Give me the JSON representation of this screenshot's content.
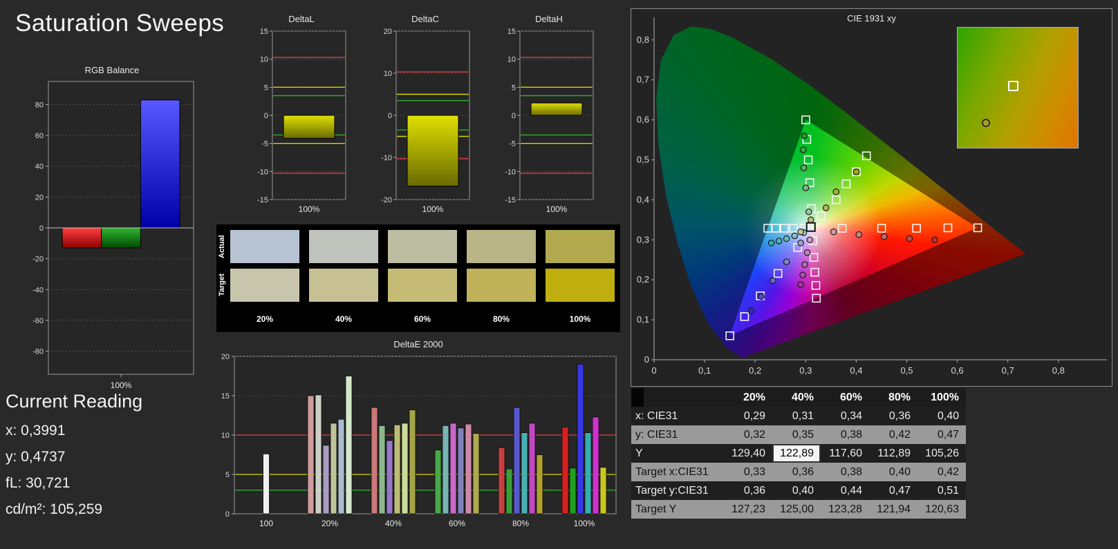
{
  "page": {
    "title": "Saturation Sweeps"
  },
  "reading": {
    "title": "Current Reading",
    "lines": [
      "x: 0,3991",
      "y: 0,4737",
      "fL: 30,721",
      "cd/m²: 105,259"
    ]
  },
  "rgb_balance": {
    "title": "RGB Balance",
    "x_label": "100%",
    "ymin": -95,
    "ymax": 95,
    "yticks": [
      80,
      60,
      40,
      20,
      0,
      -20,
      -40,
      -60,
      -80
    ],
    "bars": [
      {
        "name": "red",
        "value": -13,
        "c1": "#ff4040",
        "c2": "#8c0000"
      },
      {
        "name": "green",
        "value": -13,
        "c1": "#30b430",
        "c2": "#004a00"
      },
      {
        "name": "blue",
        "value": 83,
        "c1": "#5858ff",
        "c2": "#0000a8"
      }
    ]
  },
  "bar_gradient": [
    "#e0e000",
    "#6a6a00"
  ],
  "delta_ref_lines": [
    {
      "value": 10.3,
      "color": "#e04040"
    },
    {
      "value": 5,
      "color": "#d6d600"
    },
    {
      "value": 3.5,
      "color": "#30b030"
    },
    {
      "value": -3.5,
      "color": "#30b030"
    },
    {
      "value": -5,
      "color": "#d6d600"
    },
    {
      "value": -10.3,
      "color": "#e04040"
    }
  ],
  "delta_charts": [
    {
      "id": "deltal",
      "title": "DeltaL",
      "x_label": "100%",
      "ymin": -15,
      "ymax": 15,
      "yticks": [
        15,
        10,
        5,
        0,
        -5,
        -10,
        -15
      ],
      "bar": -4.1
    },
    {
      "id": "deltac",
      "title": "DeltaC",
      "x_label": "100%",
      "ymin": -20,
      "ymax": 20,
      "yticks": [
        20,
        10,
        0,
        -10,
        -20
      ],
      "bar": -16.8
    },
    {
      "id": "deltah",
      "title": "DeltaH",
      "x_label": "100%",
      "ymin": -15,
      "ymax": 15,
      "yticks": [
        15,
        10,
        5,
        0,
        -5,
        -10,
        -15
      ],
      "bar": 2.2
    }
  ],
  "swatches": {
    "row_labels": [
      "Actual",
      "Target"
    ],
    "col_labels": [
      "20%",
      "40%",
      "60%",
      "80%",
      "100%"
    ],
    "rows": [
      [
        "#b7c2d3",
        "#c0c3bb",
        "#bcbda1",
        "#bab586",
        "#b2a94f"
      ],
      [
        "#c8c5ad",
        "#c6c093",
        "#c5bb75",
        "#c0b258",
        "#bfae0e"
      ]
    ]
  },
  "chart_data": {
    "type": "bar",
    "title": "DeltaE 2000",
    "ymin": 0,
    "ymax": 20,
    "yticks": [
      20,
      15,
      10,
      5,
      0
    ],
    "ref_lines": [
      {
        "value": 10,
        "color": "#e04040"
      },
      {
        "value": 5,
        "color": "#d6d600"
      },
      {
        "value": 3,
        "color": "#30b030"
      }
    ],
    "groups": [
      {
        "label": "100",
        "bars": [
          {
            "c": "#f0f0f0",
            "v": 7.6
          }
        ]
      },
      {
        "label": "20%",
        "bars": [
          {
            "c": "#d09c9c",
            "v": 15.0
          },
          {
            "c": "#cdd0c6",
            "v": 15.1
          },
          {
            "c": "#a89cc4",
            "v": 8.7
          },
          {
            "c": "#c0c298",
            "v": 11.5
          },
          {
            "c": "#a8bcd0",
            "v": 12.0
          },
          {
            "c": "#d4e8cc",
            "v": 17.5
          }
        ]
      },
      {
        "label": "40%",
        "bars": [
          {
            "c": "#cc7878",
            "v": 13.5
          },
          {
            "c": "#8cb88c",
            "v": 11.2
          },
          {
            "c": "#9678c8",
            "v": 9.3
          },
          {
            "c": "#bcbc74",
            "v": 11.3
          },
          {
            "c": "#ccdc9c",
            "v": 11.5
          },
          {
            "c": "#a4a448",
            "v": 13.2
          }
        ]
      },
      {
        "label": "60%",
        "bars": [
          {
            "c": "#48a848",
            "v": 8.1
          },
          {
            "c": "#78b4b4",
            "v": 11.2
          },
          {
            "c": "#c868c8",
            "v": 11.5
          },
          {
            "c": "#8080b8",
            "v": 10.9
          },
          {
            "c": "#d088a8",
            "v": 11.4
          },
          {
            "c": "#b0a84c",
            "v": 10.2
          }
        ]
      },
      {
        "label": "80%",
        "bars": [
          {
            "c": "#c84040",
            "v": 8.4
          },
          {
            "c": "#38a038",
            "v": 5.7
          },
          {
            "c": "#5858cc",
            "v": 13.5
          },
          {
            "c": "#48b0b0",
            "v": 10.3
          },
          {
            "c": "#c048c0",
            "v": 11.5
          },
          {
            "c": "#b0a030",
            "v": 7.5
          }
        ]
      },
      {
        "label": "100%",
        "bars": [
          {
            "c": "#d82020",
            "v": 11.0
          },
          {
            "c": "#20a020",
            "v": 5.8
          },
          {
            "c": "#3838e8",
            "v": 19.0
          },
          {
            "c": "#30b0b0",
            "v": 10.3
          },
          {
            "c": "#d030d0",
            "v": 12.3
          },
          {
            "c": "#c8c820",
            "v": 5.9
          }
        ]
      }
    ]
  },
  "cie": {
    "title": "CIE 1931 xy",
    "xticks": [
      "0",
      "0,1",
      "0,2",
      "0,3",
      "0,4",
      "0,5",
      "0,6",
      "0,7",
      "0,8"
    ],
    "yticks": [
      "0",
      "0,1",
      "0,2",
      "0,3",
      "0,4",
      "0,5",
      "0,6",
      "0,7",
      "0,8"
    ],
    "targets": [
      [
        0.372,
        0.329
      ],
      [
        0.45,
        0.329
      ],
      [
        0.519,
        0.329
      ],
      [
        0.581,
        0.33
      ],
      [
        0.64,
        0.33
      ],
      [
        0.311,
        0.378
      ],
      [
        0.308,
        0.443
      ],
      [
        0.305,
        0.5
      ],
      [
        0.302,
        0.551
      ],
      [
        0.3,
        0.6
      ],
      [
        0.284,
        0.281
      ],
      [
        0.245,
        0.216
      ],
      [
        0.21,
        0.16
      ],
      [
        0.179,
        0.108
      ],
      [
        0.15,
        0.06
      ],
      [
        0.297,
        0.329
      ],
      [
        0.276,
        0.329
      ],
      [
        0.258,
        0.329
      ],
      [
        0.241,
        0.329
      ],
      [
        0.225,
        0.329
      ],
      [
        0.314,
        0.298
      ],
      [
        0.316,
        0.256
      ],
      [
        0.318,
        0.219
      ],
      [
        0.32,
        0.186
      ],
      [
        0.321,
        0.154
      ],
      [
        0.33,
        0.36
      ],
      [
        0.36,
        0.4
      ],
      [
        0.38,
        0.44
      ],
      [
        0.4,
        0.47
      ],
      [
        0.42,
        0.51
      ]
    ],
    "measured": [
      [
        0.355,
        0.32,
        "#d4a0a0"
      ],
      [
        0.405,
        0.313,
        "#cc8484"
      ],
      [
        0.455,
        0.308,
        "#c86868"
      ],
      [
        0.505,
        0.303,
        "#c44c4c"
      ],
      [
        0.555,
        0.3,
        "#c03030"
      ],
      [
        0.306,
        0.37,
        "#a0c8a0"
      ],
      [
        0.3,
        0.43,
        "#80bc80"
      ],
      [
        0.296,
        0.48,
        "#60b060"
      ],
      [
        0.295,
        0.525,
        "#40a440"
      ],
      [
        0.297,
        0.56,
        "#209820"
      ],
      [
        0.29,
        0.292,
        "#a0a0d4"
      ],
      [
        0.262,
        0.245,
        "#8484cc"
      ],
      [
        0.235,
        0.198,
        "#6868c8"
      ],
      [
        0.212,
        0.158,
        "#4c4cc4"
      ],
      [
        0.192,
        0.122,
        "#3030c0"
      ],
      [
        0.296,
        0.318,
        "#a0cccc"
      ],
      [
        0.278,
        0.31,
        "#84c4c4"
      ],
      [
        0.262,
        0.303,
        "#68bcbc"
      ],
      [
        0.247,
        0.297,
        "#4cb4b4"
      ],
      [
        0.232,
        0.292,
        "#30acac"
      ],
      [
        0.308,
        0.3,
        "#cca0cc"
      ],
      [
        0.303,
        0.268,
        "#c484c4"
      ],
      [
        0.298,
        0.238,
        "#bc68bc"
      ],
      [
        0.294,
        0.212,
        "#b44cb4"
      ],
      [
        0.29,
        0.188,
        "#ac30ac"
      ],
      [
        0.29,
        0.32,
        "#c8c890"
      ],
      [
        0.31,
        0.35,
        "#c0c074"
      ],
      [
        0.34,
        0.38,
        "#b8b858"
      ],
      [
        0.36,
        0.42,
        "#b0b03c"
      ],
      [
        0.4,
        0.47,
        "#a8a820"
      ]
    ],
    "marker": [
      0.31,
      0.332
    ]
  },
  "table": {
    "header": [
      "",
      "20%",
      "40%",
      "60%",
      "80%",
      "100%"
    ],
    "rows": [
      {
        "label": "x: CIE31",
        "values": [
          "0,29",
          "0,31",
          "0,34",
          "0,36",
          "0,40"
        ],
        "shade": "dark"
      },
      {
        "label": "y: CIE31",
        "values": [
          "0,32",
          "0,35",
          "0,38",
          "0,42",
          "0,47"
        ],
        "shade": "light"
      },
      {
        "label": "Y",
        "values": [
          "129,40",
          "122,89",
          "117,60",
          "112,89",
          "105,26"
        ],
        "shade": "dark",
        "highlight": 1
      },
      {
        "label": "Target x:CIE31",
        "values": [
          "0,33",
          "0,36",
          "0,38",
          "0,40",
          "0,42"
        ],
        "shade": "light"
      },
      {
        "label": "Target y:CIE31",
        "values": [
          "0,36",
          "0,40",
          "0,44",
          "0,47",
          "0,51"
        ],
        "shade": "dark"
      },
      {
        "label": "Target Y",
        "values": [
          "127,23",
          "125,00",
          "123,28",
          "121,94",
          "120,63"
        ],
        "shade": "light"
      }
    ]
  }
}
